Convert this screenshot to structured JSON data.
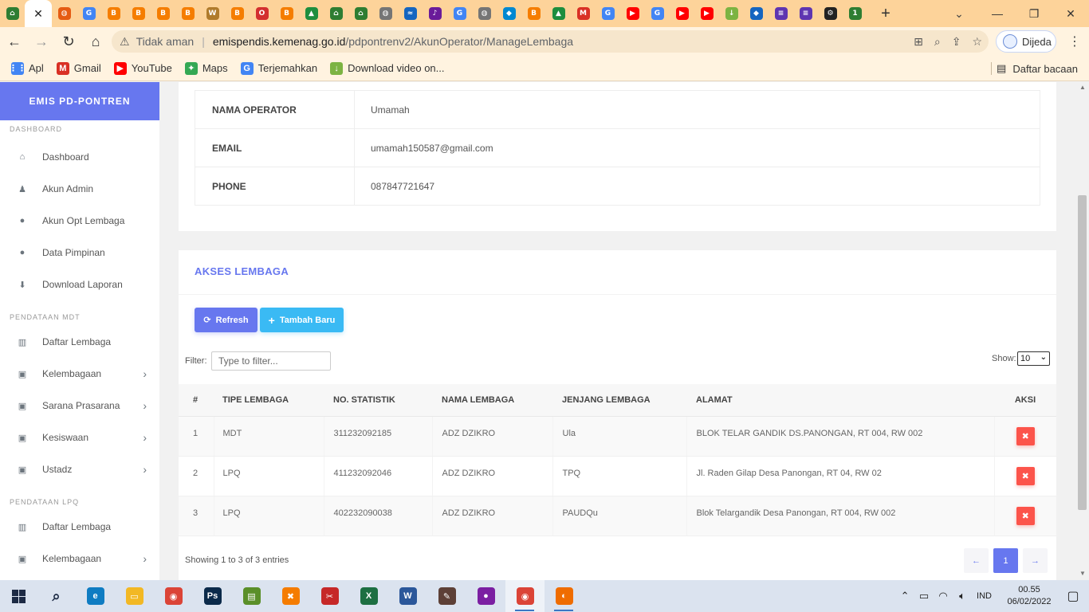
{
  "browser": {
    "tabs": [
      {
        "icon": "kemenag-logo-icon",
        "color": "#2e7d32",
        "glyph": "⌂"
      },
      {
        "icon": "close-icon",
        "active": true,
        "glyph": "✕"
      },
      {
        "icon": "globe-icon",
        "color": "#e55b13",
        "glyph": "◍"
      },
      {
        "icon": "google-icon",
        "color": "#4285f4",
        "glyph": "G"
      },
      {
        "icon": "blogger-icon",
        "color": "#f57d00",
        "glyph": "B"
      },
      {
        "icon": "blogger-icon",
        "color": "#f57d00",
        "glyph": "B"
      },
      {
        "icon": "blogger-icon",
        "color": "#f57d00",
        "glyph": "B"
      },
      {
        "icon": "blogger-icon",
        "color": "#f57d00",
        "glyph": "B"
      },
      {
        "icon": "wattpad-icon",
        "color": "#b07b2c",
        "glyph": "W"
      },
      {
        "icon": "blogger-icon",
        "color": "#f57d00",
        "glyph": "B"
      },
      {
        "icon": "opera-icon",
        "color": "#d32f2f",
        "glyph": "O"
      },
      {
        "icon": "blogger-icon",
        "color": "#f57d00",
        "glyph": "B"
      },
      {
        "icon": "drive-icon",
        "color": "#1e8e3e",
        "glyph": "▲"
      },
      {
        "icon": "kemenag-logo-icon",
        "color": "#2e7d32",
        "glyph": "⌂"
      },
      {
        "icon": "kemenag-logo-icon",
        "color": "#2e7d32",
        "glyph": "⌂"
      },
      {
        "icon": "globe-icon",
        "color": "#757575",
        "glyph": "◍"
      },
      {
        "icon": "chart-icon",
        "color": "#1565c0",
        "glyph": "≈"
      },
      {
        "icon": "tiktok-icon",
        "color": "#6a1b9a",
        "glyph": "♪"
      },
      {
        "icon": "google-icon",
        "color": "#4285f4",
        "glyph": "G"
      },
      {
        "icon": "globe-icon",
        "color": "#757575",
        "glyph": "◍"
      },
      {
        "icon": "app-icon",
        "color": "#0288d1",
        "glyph": "◆"
      },
      {
        "icon": "blogger-icon",
        "color": "#f57d00",
        "glyph": "B"
      },
      {
        "icon": "drive-icon",
        "color": "#1e8e3e",
        "glyph": "▲"
      },
      {
        "icon": "gmail-icon",
        "color": "#d93025",
        "glyph": "M"
      },
      {
        "icon": "translate-icon",
        "color": "#4285f4",
        "glyph": "G"
      },
      {
        "icon": "youtube-icon",
        "color": "#ff0000",
        "glyph": "▶"
      },
      {
        "icon": "google-icon",
        "color": "#4285f4",
        "glyph": "G"
      },
      {
        "icon": "youtube-icon",
        "color": "#ff0000",
        "glyph": "▶"
      },
      {
        "icon": "youtube-icon",
        "color": "#ff0000",
        "glyph": "▶"
      },
      {
        "icon": "download-icon",
        "color": "#7cb342",
        "glyph": "↓"
      },
      {
        "icon": "app-icon",
        "color": "#1565c0",
        "glyph": "◆"
      },
      {
        "icon": "list-icon",
        "color": "#5e35b1",
        "glyph": "≡"
      },
      {
        "icon": "list-icon",
        "color": "#5e35b1",
        "glyph": "≡"
      },
      {
        "icon": "gear-icon",
        "color": "#222222",
        "glyph": "⚙"
      },
      {
        "icon": "app-icon",
        "color": "#2e7d32",
        "glyph": "1"
      }
    ],
    "new_tab_glyph": "+",
    "url_warning": "Tidak aman",
    "url_domain": "emispendis.kemenag.go.id",
    "url_path": "/pdpontrenv2/AkunOperator/ManageLembaga",
    "profile_label": "Dijeda",
    "bookmarks": [
      {
        "label": "Apl",
        "icon": "apps-grid-icon",
        "color": "#4285f4",
        "glyph": "⋮⋮"
      },
      {
        "label": "Gmail",
        "icon": "gmail-icon",
        "color": "#d93025",
        "glyph": "M"
      },
      {
        "label": "YouTube",
        "icon": "youtube-icon",
        "color": "#ff0000",
        "glyph": "▶"
      },
      {
        "label": "Maps",
        "icon": "maps-icon",
        "color": "#34a853",
        "glyph": "✦"
      },
      {
        "label": "Terjemahkan",
        "icon": "translate-icon",
        "color": "#4285f4",
        "glyph": "G"
      },
      {
        "label": "Download video on...",
        "icon": "download-icon",
        "color": "#7cb342",
        "glyph": "↓"
      }
    ],
    "reading_list": "Daftar bacaan"
  },
  "sidebar": {
    "brand": "EMIS PD-PONTREN",
    "sections": [
      {
        "header": "DASHBOARD",
        "items": [
          {
            "label": "Dashboard",
            "icon": "home-icon",
            "glyph": "⌂",
            "submenu": false
          },
          {
            "label": "Akun Admin",
            "icon": "user-tie-icon",
            "glyph": "♟",
            "submenu": false
          },
          {
            "label": "Akun Opt Lembaga",
            "icon": "user-icon",
            "glyph": "●",
            "submenu": false
          },
          {
            "label": "Data Pimpinan",
            "icon": "user-icon",
            "glyph": "●",
            "submenu": false
          },
          {
            "label": "Download Laporan",
            "icon": "download-icon",
            "glyph": "⬇",
            "submenu": false
          }
        ]
      },
      {
        "header": "PENDATAAN MDT",
        "items": [
          {
            "label": "Daftar Lembaga",
            "icon": "university-icon",
            "glyph": "▥",
            "submenu": false
          },
          {
            "label": "Kelembagaan",
            "icon": "columns-icon",
            "glyph": "▣",
            "submenu": true
          },
          {
            "label": "Sarana Prasarana",
            "icon": "columns-icon",
            "glyph": "▣",
            "submenu": true
          },
          {
            "label": "Kesiswaan",
            "icon": "columns-icon",
            "glyph": "▣",
            "submenu": true
          },
          {
            "label": "Ustadz",
            "icon": "columns-icon",
            "glyph": "▣",
            "submenu": true
          }
        ]
      },
      {
        "header": "PENDATAAN LPQ",
        "items": [
          {
            "label": "Daftar Lembaga",
            "icon": "university-icon",
            "glyph": "▥",
            "submenu": false
          },
          {
            "label": "Kelembagaan",
            "icon": "columns-icon",
            "glyph": "▣",
            "submenu": true
          }
        ]
      }
    ]
  },
  "operator": {
    "rows": [
      {
        "label": "NAMA OPERATOR",
        "value": "Umamah"
      },
      {
        "label": "EMAIL",
        "value": "umamah150587@gmail.com"
      },
      {
        "label": "PHONE",
        "value": "087847721647"
      }
    ]
  },
  "akses": {
    "title": "AKSES LEMBAGA",
    "refresh_label": "Refresh",
    "add_label": "Tambah Baru",
    "filter_label": "Filter:",
    "filter_placeholder": "Type to filter...",
    "show_label": "Show:",
    "show_value": "10",
    "columns": [
      "#",
      "TIPE LEMBAGA",
      "NO. STATISTIK",
      "NAMA LEMBAGA",
      "JENJANG LEMBAGA",
      "ALAMAT",
      "AKSI"
    ],
    "rows": [
      {
        "no": "1",
        "tipe": "MDT",
        "statistik": "311232092185",
        "nama": "ADZ DZIKRO",
        "jenjang": "Ula",
        "alamat": "BLOK TELAR GANDIK DS.PANONGAN, RT 004, RW 002"
      },
      {
        "no": "2",
        "tipe": "LPQ",
        "statistik": "411232092046",
        "nama": "ADZ DZIKRO",
        "jenjang": "TPQ",
        "alamat": "Jl. Raden Gilap Desa Panongan, RT 04, RW 02"
      },
      {
        "no": "3",
        "tipe": "LPQ",
        "statistik": "402232090038",
        "nama": "ADZ DZIKRO",
        "jenjang": "PAUDQu",
        "alamat": "Blok Telargandik Desa Panongan, RT 004, RW 002"
      }
    ],
    "delete_glyph": "✖",
    "showing_text": "Showing 1 to 3 of 3 entries",
    "pager": {
      "prev": "←",
      "current": "1",
      "next": "→"
    }
  },
  "taskbar": {
    "apps": [
      {
        "icon": "search-icon",
        "color": "#dbe3ef",
        "glyph": "⌕",
        "running": false
      },
      {
        "icon": "edge-icon",
        "color": "#0f7cc2",
        "glyph": "e",
        "running": false
      },
      {
        "icon": "file-explorer-icon",
        "color": "#f2b824",
        "glyph": "▭",
        "running": false
      },
      {
        "icon": "chrome-icon",
        "color": "#db4437",
        "glyph": "◉",
        "running": false
      },
      {
        "icon": "photoshop-icon",
        "color": "#0b2a4a",
        "glyph": "Ps",
        "running": false
      },
      {
        "icon": "chart-app-icon",
        "color": "#5a8f29",
        "glyph": "▤",
        "running": false
      },
      {
        "icon": "xampp-icon",
        "color": "#f57c00",
        "glyph": "✖",
        "running": false
      },
      {
        "icon": "snipping-tool-icon",
        "color": "#c62828",
        "glyph": "✂",
        "running": false
      },
      {
        "icon": "excel-icon",
        "color": "#1d6f42",
        "glyph": "X",
        "running": false
      },
      {
        "icon": "word-icon",
        "color": "#2b579a",
        "glyph": "W",
        "running": false
      },
      {
        "icon": "design-app-icon",
        "color": "#5d4037",
        "glyph": "✎",
        "running": false
      },
      {
        "icon": "paint-drop-icon",
        "color": "#7b1fa2",
        "glyph": "●",
        "running": false
      },
      {
        "icon": "chrome-icon",
        "color": "#db4437",
        "glyph": "◉",
        "running": true,
        "current": true
      },
      {
        "icon": "app-icon",
        "color": "#ef6c00",
        "glyph": "◐",
        "running": true
      }
    ],
    "language": "IND",
    "time": "00.55",
    "date": "06/02/2022"
  },
  "colors": {
    "primary": "#6777ef",
    "info": "#3abaf4",
    "danger": "#fc544b",
    "tab_strip": "#fdd39a"
  }
}
